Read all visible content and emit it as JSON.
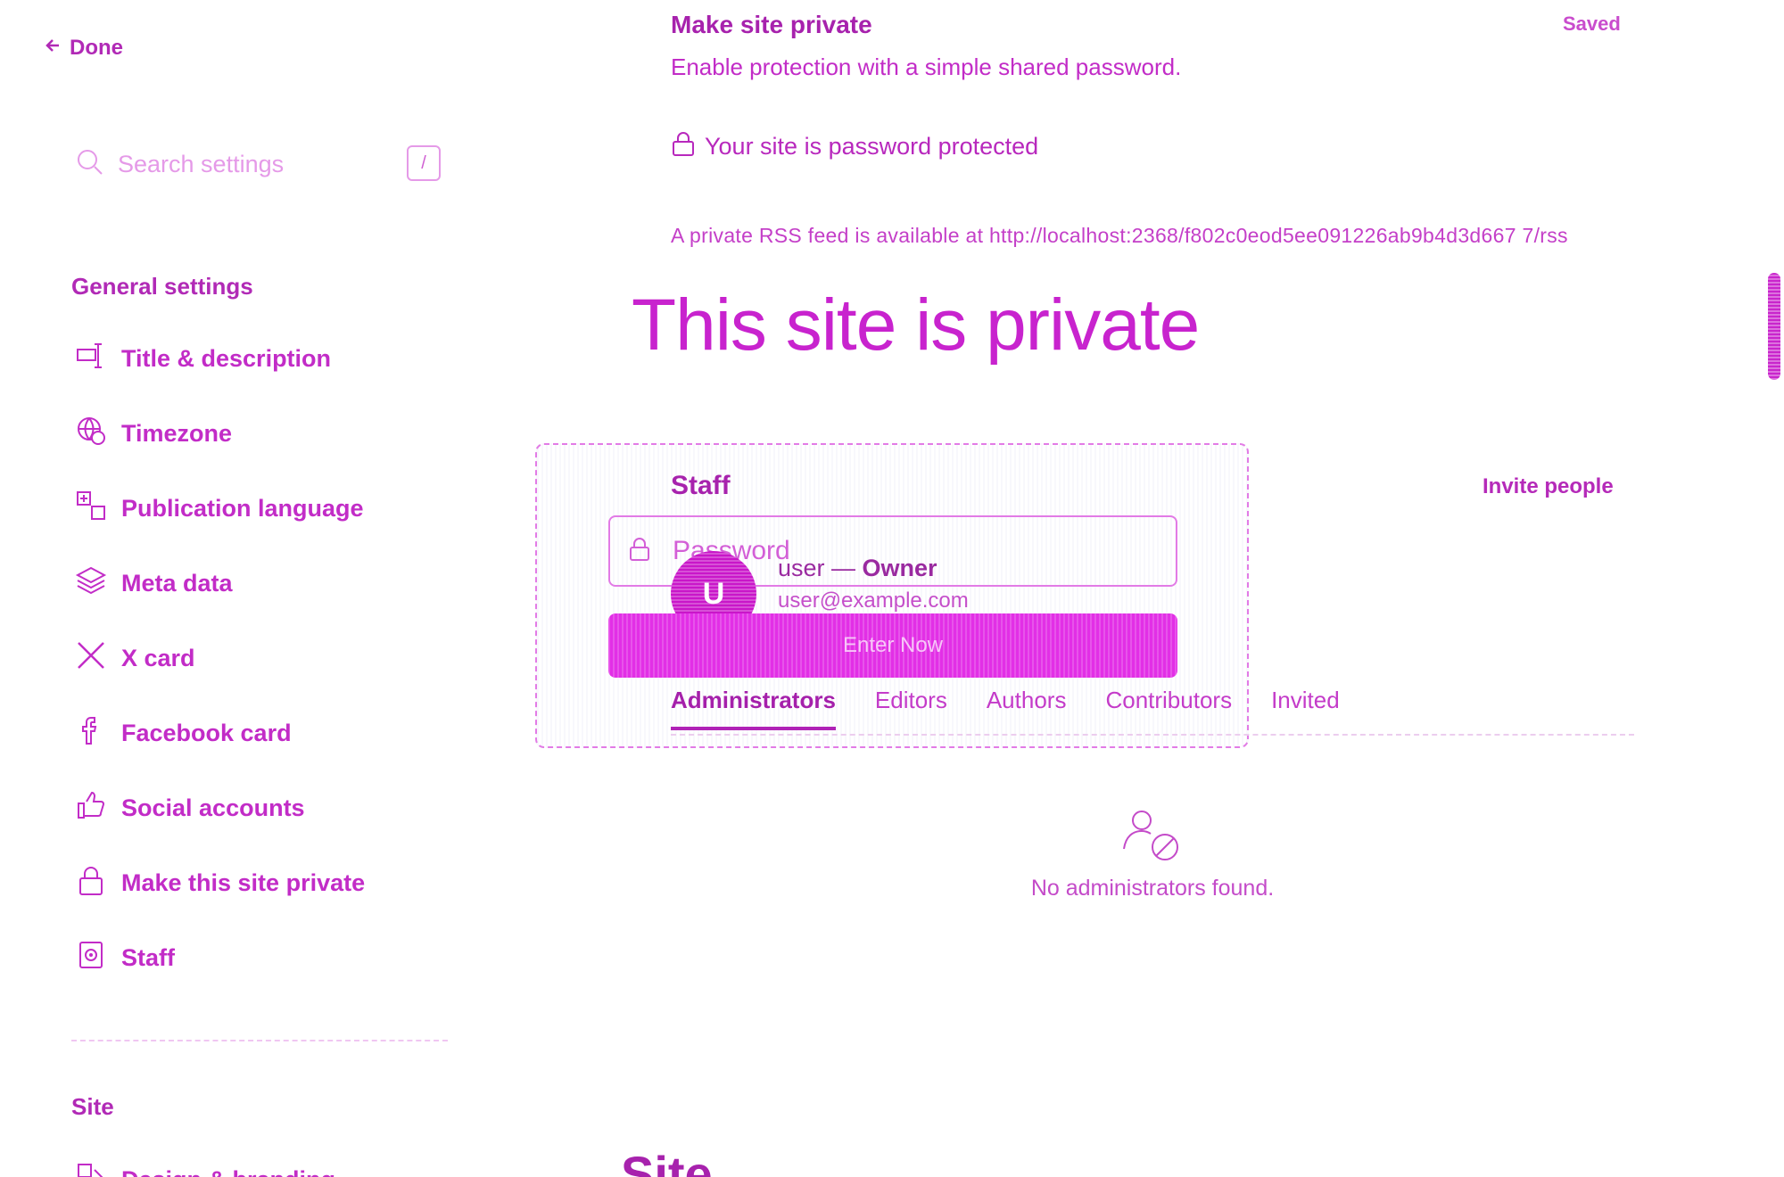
{
  "nav": {
    "done_label": "Done",
    "search": {
      "placeholder": "Search settings",
      "shortcut": "/"
    }
  },
  "sidebar": {
    "general_title": "General settings",
    "items": [
      {
        "label": "Title & description",
        "icon": "title-description-icon"
      },
      {
        "label": "Timezone",
        "icon": "globe-clock-icon"
      },
      {
        "label": "Publication language",
        "icon": "language-icon"
      },
      {
        "label": "Meta data",
        "icon": "layers-icon"
      },
      {
        "label": "X card",
        "icon": "x-logo-icon"
      },
      {
        "label": "Facebook card",
        "icon": "facebook-icon"
      },
      {
        "label": "Social accounts",
        "icon": "thumbs-up-icon"
      },
      {
        "label": "Make this site private",
        "icon": "lock-icon"
      },
      {
        "label": "Staff",
        "icon": "staff-badge-icon"
      }
    ],
    "site_title": "Site",
    "site_items": [
      {
        "label": "Design & branding",
        "icon": "design-icon"
      }
    ]
  },
  "privacy": {
    "title": "Make site private",
    "status": "Saved",
    "description": "Enable protection with a simple shared password.",
    "protected_text": "Your site is password protected",
    "rss_text": "A private RSS feed is available at http://localhost:2368/f802c0eod5ee091226ab9b4d3d667 7/rss"
  },
  "private_page": {
    "heading": "This site is private",
    "password_placeholder": "Password",
    "button_label": "Enter Now"
  },
  "staff": {
    "title": "Staff",
    "invite_label": "Invite people",
    "owner": {
      "avatar_initial": "U",
      "name": "user",
      "separator": " — ",
      "role": "Owner",
      "email": "user@example.com"
    },
    "tabs": [
      "Administrators",
      "Editors",
      "Authors",
      "Contributors",
      "Invited"
    ],
    "active_tab": "Administrators",
    "empty_text": "No administrators found."
  },
  "site_heading": "Site",
  "colors": {
    "accent": "#c22cc7",
    "button": "#e22fe6"
  }
}
